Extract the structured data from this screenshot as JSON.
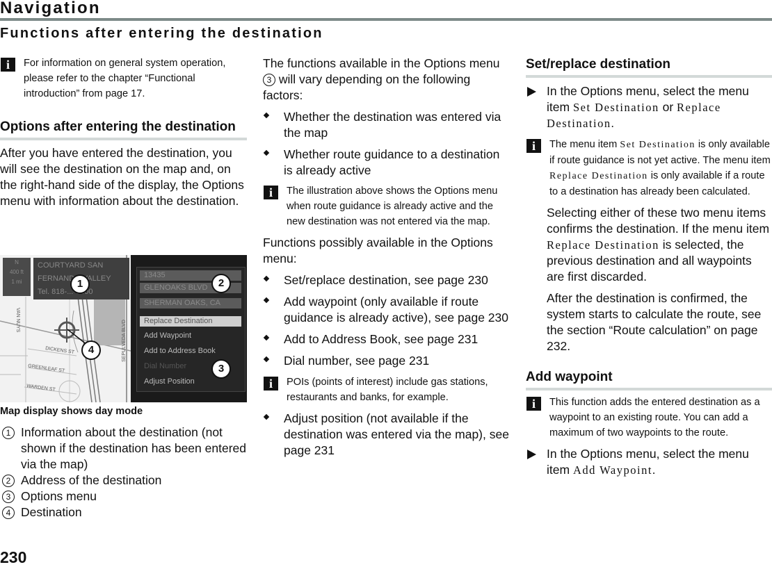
{
  "header": {
    "chapter": "Navigation",
    "section_title": "Functions after entering the destination"
  },
  "column1": {
    "note_general": "For information on general system operation, please refer to the chapter “Functional introduction” from page 17.",
    "subheading": "Options after entering the destination",
    "intro": "After you have entered the destination, you will see the destination on the map and, on the right-hand side of the display, the Options menu with information about the destination.",
    "figure": {
      "info_box_lines": [
        "COURTYARD SAN",
        "FERNANDO VALLEY",
        "Tel. 818-...-6400"
      ],
      "small_box_lines": [
        "N",
        "400 ft",
        "1 mi"
      ],
      "address_rows": [
        "13435",
        "GLENOAKS BLVD",
        "SHERMAN OAKS, CA"
      ],
      "menu_items": [
        "Replace Destination",
        "Add Waypoint",
        "Add to Address Book",
        "Dial Number",
        "Adjust Position"
      ],
      "selected_item": "Replace Destination",
      "disabled_item": "Dial Number",
      "streets": [
        "DICKENS ST",
        "GREENLEAF ST",
        "WARDEN ST",
        "SEPULVEDA BLVD",
        "VAN NUYS"
      ],
      "callouts": [
        "1",
        "2",
        "3",
        "4"
      ]
    },
    "caption": "Map display shows day mode",
    "legend": [
      {
        "num": "1",
        "text": "Information about the destination (not shown if the destination has been entered via the map)"
      },
      {
        "num": "2",
        "text": "Address of the destination"
      },
      {
        "num": "3",
        "text": "Options menu"
      },
      {
        "num": "4",
        "text": "Destination"
      }
    ]
  },
  "column2": {
    "intro_a": "The functions available in the Options menu",
    "intro_ref": "3",
    "intro_b": "will vary depending on the following factors:",
    "factors": [
      "Whether the destination was entered via the map",
      "Whether route guidance to a destination is already active"
    ],
    "note_illustration": "The illustration above shows the Options menu when route guidance is already active and the new destination was not entered via the map.",
    "functions_intro": "Functions possibly available in the Options menu:",
    "functions": [
      "Set/replace destination, see page 230",
      "Add waypoint (only available if route guidance is already active), see page 230",
      "Add to Address Book, see page 231",
      "Dial number, see page 231"
    ],
    "note_poi": "POIs (points of interest) include gas stations, restaurants and banks, for example.",
    "functions_more": [
      "Adjust position (not available if the destination was entered via the map), see page 231"
    ]
  },
  "column3": {
    "set_replace": {
      "heading": "Set/replace destination",
      "step_a": "In the Options menu, select the menu item",
      "menu_set": "Set Destination",
      "step_or": "or",
      "menu_replace": "Replace Destination",
      "step_end": ".",
      "note_a": "The menu item",
      "note_b": "is only available if route guidance is not yet active. The menu item",
      "note_c": "is only available if a route to a destination has already been calculated.",
      "para1_a": "Selecting either of these two menu items confirms the destination. If the menu item",
      "para1_b": "is selected, the previous destination and all waypoints are first discarded.",
      "para2": "After the destination is confirmed, the system starts to calculate the route, see the section “Route calculation” on page 232."
    },
    "add_waypoint": {
      "heading": "Add waypoint",
      "note": "This function adds the entered destination as a waypoint to an existing route. You can add a maximum of two waypoints to the route.",
      "step_a": "In the Options menu, select the menu item",
      "menu_item": "Add Waypoint",
      "step_end": "."
    }
  },
  "footer": {
    "page_number": "230"
  },
  "icons": {
    "info": "i"
  }
}
